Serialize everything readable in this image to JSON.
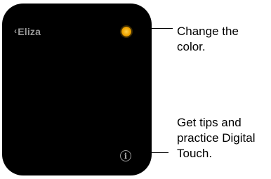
{
  "watch": {
    "back_label": "Eliza",
    "back_chevron": "‹",
    "info_glyph": "i",
    "color_button_color": "#f0a400",
    "screen_background": "#000000"
  },
  "callouts": {
    "color": {
      "line1": "Change the",
      "line2": "color."
    },
    "tips": {
      "line1": "Get tips and",
      "line2": "practice Digital",
      "line3": "Touch."
    }
  },
  "icons": {
    "back": "chevron-left-icon",
    "color": "color-dot-icon",
    "info": "info-icon"
  }
}
